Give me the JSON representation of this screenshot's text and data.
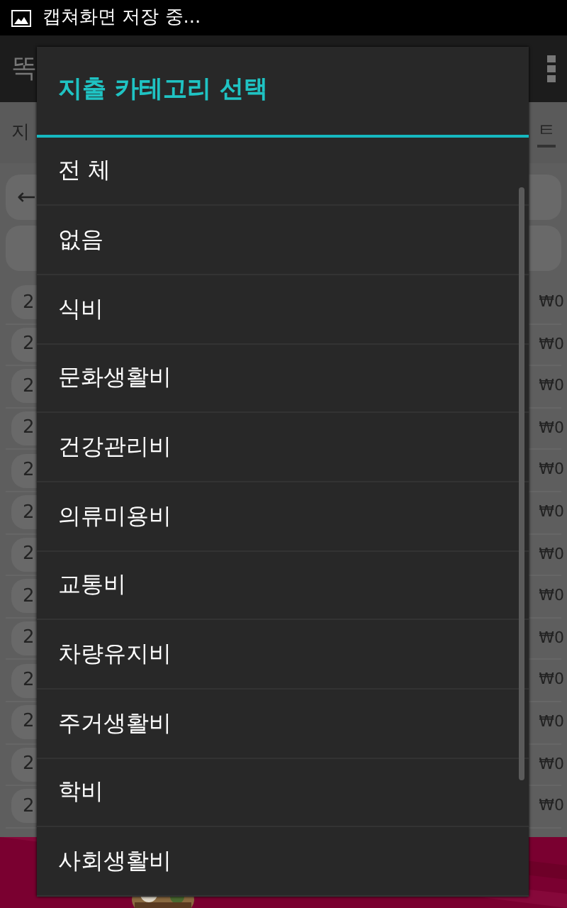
{
  "status_bar": {
    "notification": "캡쳐화면 저장 중..."
  },
  "background": {
    "app_title": "똑",
    "tabs": [
      {
        "label": "지"
      },
      {
        "label": "ㅌ"
      }
    ],
    "back_arrow": "←",
    "rows": [
      {
        "column_1": "2",
        "column_2": "₩0"
      },
      {
        "column_1": "2",
        "column_2": "₩0"
      },
      {
        "column_1": "2",
        "column_2": "₩0"
      },
      {
        "column_1": "2",
        "column_2": "₩0"
      },
      {
        "column_1": "2",
        "column_2": "₩0"
      },
      {
        "column_1": "2",
        "column_2": "₩0"
      },
      {
        "column_1": "2",
        "column_2": "₩0"
      },
      {
        "column_1": "2",
        "column_2": "₩0"
      },
      {
        "column_1": "2",
        "column_2": "₩0"
      },
      {
        "column_1": "2",
        "column_2": "₩0"
      },
      {
        "column_1": "2",
        "column_2": "₩0"
      },
      {
        "column_1": "2",
        "column_2": "₩0"
      },
      {
        "column_1": "2",
        "column_2": "₩0"
      }
    ]
  },
  "dialog": {
    "title": "지출 카테고리 선택",
    "items": [
      "전 체",
      "없음",
      "식비",
      "문화생활비",
      "건강관리비",
      "의류미용비",
      "교통비",
      "차량유지비",
      "주거생활비",
      "학비",
      "사회생활비"
    ]
  }
}
